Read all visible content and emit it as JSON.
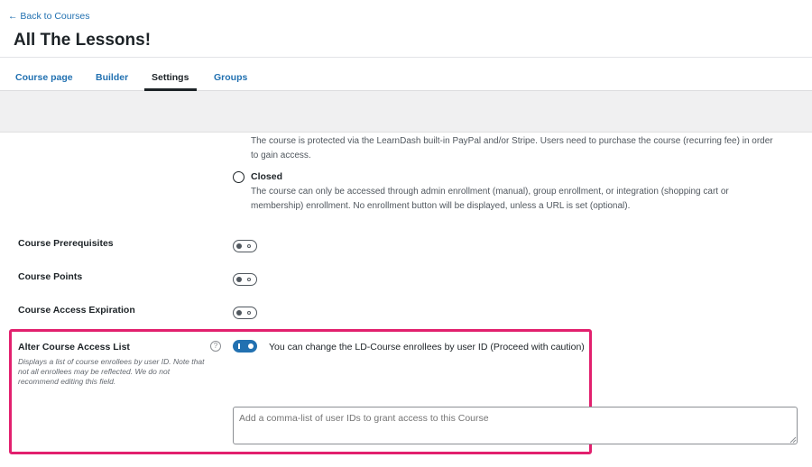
{
  "header": {
    "back_link": "← Back to Courses",
    "title": "All The Lessons!",
    "tabs": [
      {
        "label": "Course page"
      },
      {
        "label": "Builder"
      },
      {
        "label": "Settings"
      },
      {
        "label": "Groups"
      }
    ],
    "active_tab": "Settings"
  },
  "access_mode": {
    "recurring_desc_line1": "The course is protected via the LearnDash built-in PayPal and/or Stripe. Users need to purchase the course (recurring fee) in order",
    "recurring_desc_line2": "to gain access.",
    "closed_label": "Closed",
    "closed_desc_line1": "The course can only be accessed through admin enrollment (manual), group enrollment, or integration (shopping cart or",
    "closed_desc_line2": "membership) enrollment. No enrollment button will be displayed, unless a URL is set (optional)."
  },
  "settings": {
    "prerequisites_label": "Course Prerequisites",
    "points_label": "Course Points",
    "expiration_label": "Course Access Expiration"
  },
  "access_list": {
    "label": "Alter Course Access List",
    "help_icon": "?",
    "help_text": "Displays a list of course enrollees by user ID. Note that not all enrollees may be reflected. We do not recommend editing this field.",
    "toggle_desc": "You can change the LD-Course enrollees by user ID (Proceed with caution)",
    "textarea_placeholder": "Add a comma-list of user IDs to grant access to this Course",
    "highlight_color": "#e2206e"
  },
  "colors": {
    "link": "#2271b1",
    "toggle_on": "#2271b1"
  }
}
